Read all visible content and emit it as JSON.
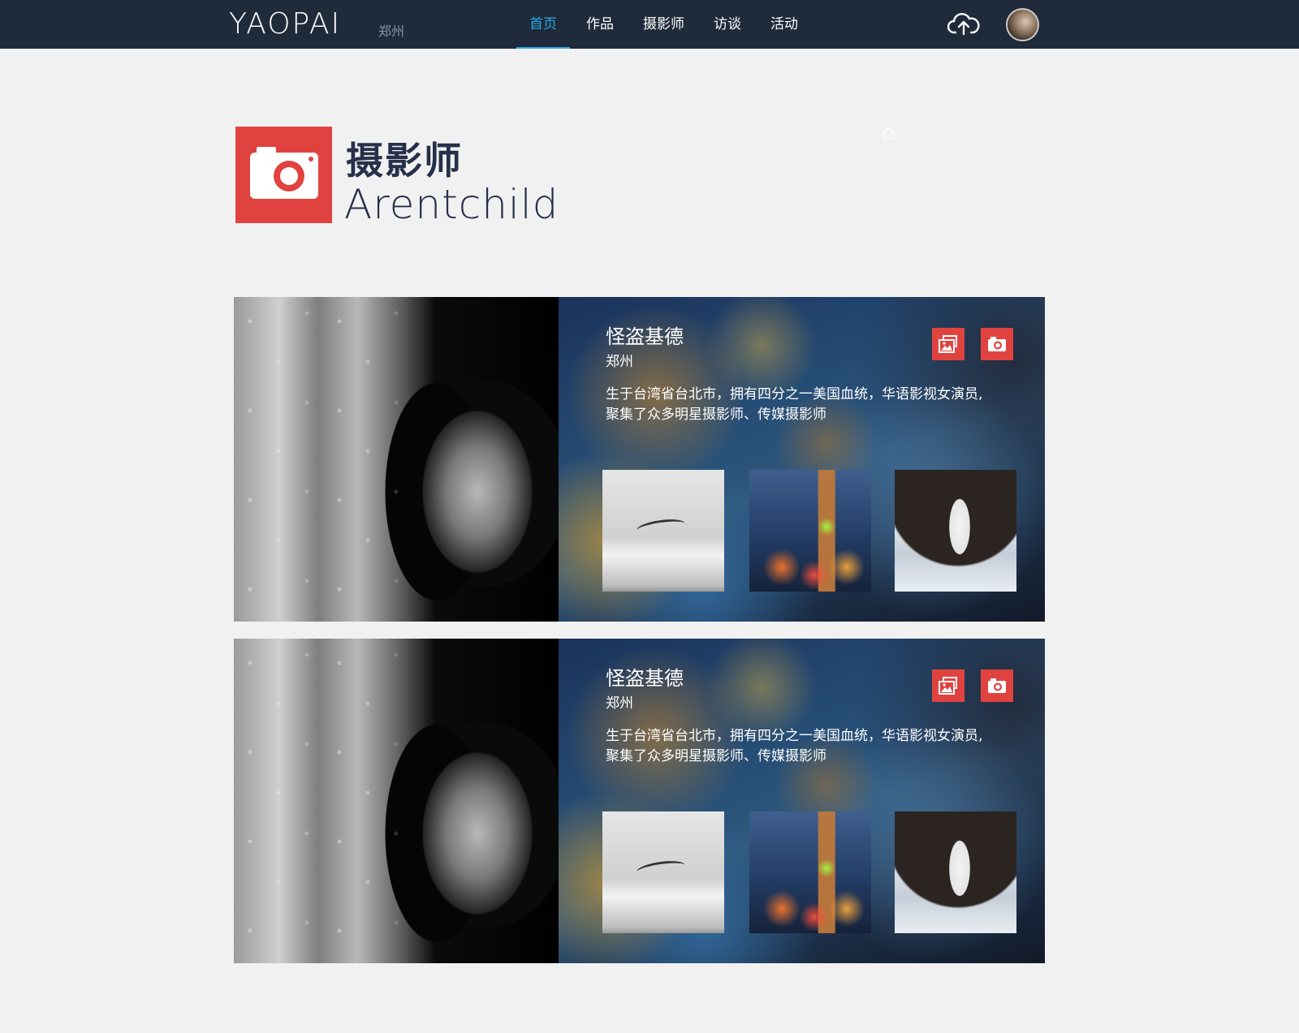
{
  "header": {
    "logo": "YAOPAI",
    "city": "郑州",
    "nav": [
      "首页",
      "作品",
      "摄影师",
      "访谈",
      "活动"
    ],
    "active_nav": "首页",
    "accent_color": "#2aa9e8",
    "bar_color": "#1f2a3a"
  },
  "page": {
    "title": "摄影师",
    "subtitle": "Arentchild",
    "brand_red": "#e0433f"
  },
  "photographers": [
    {
      "name": "怪盗基德",
      "city": "郑州",
      "description": "生于台湾省台北市，拥有四分之一美国血统，华语影视女演员,聚集了众多明星摄影师、传媒摄影师",
      "actions": [
        "gallery-icon",
        "camera-icon"
      ],
      "thumbs": [
        "seagull-photo",
        "big-ben-photo",
        "girl-photo"
      ]
    },
    {
      "name": "怪盗基德",
      "city": "郑州",
      "description": "生于台湾省台北市，拥有四分之一美国血统，华语影视女演员,聚集了众多明星摄影师、传媒摄影师",
      "actions": [
        "gallery-icon",
        "camera-icon"
      ],
      "thumbs": [
        "seagull-photo",
        "big-ben-photo",
        "girl-photo"
      ]
    }
  ]
}
